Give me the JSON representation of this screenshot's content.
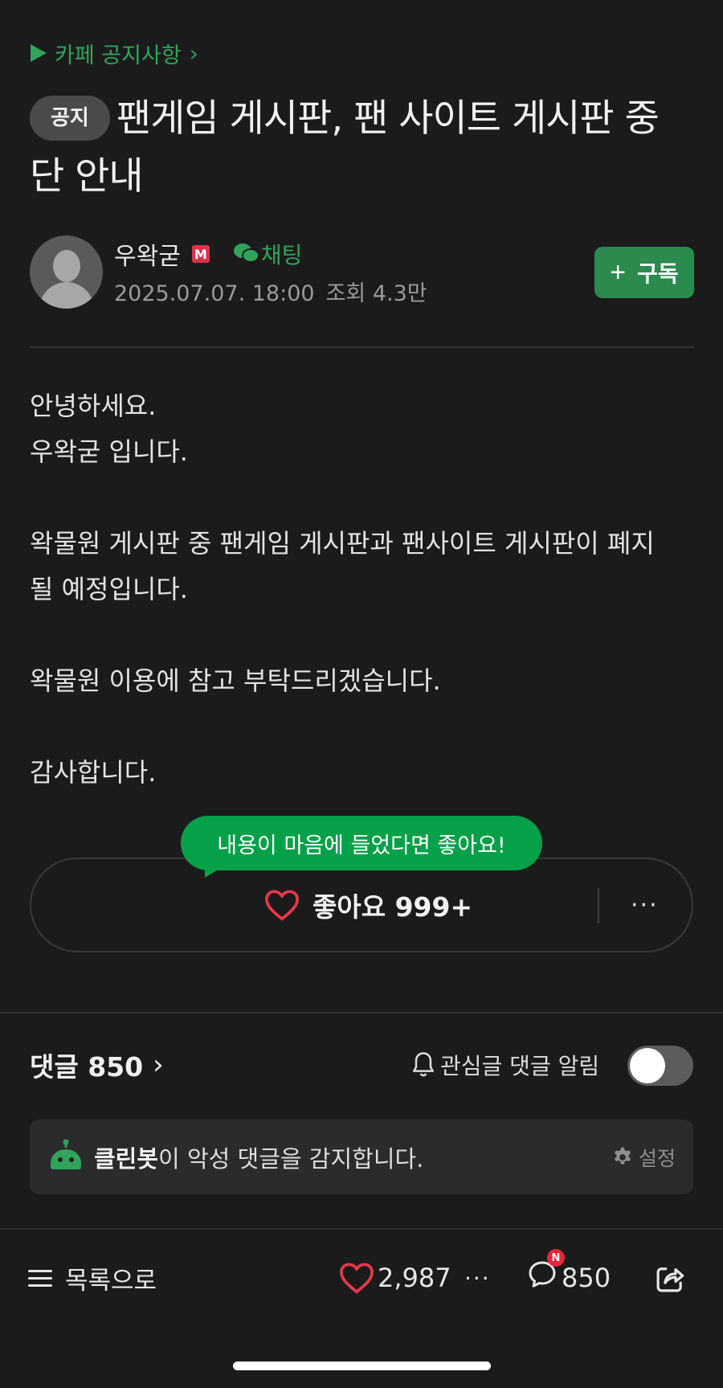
{
  "breadcrumb": {
    "label": "카페 공지사항"
  },
  "post": {
    "badge": "공지",
    "title": "팬게임 게시판, 팬 사이트 게시판 중단 안내",
    "author": "우왁굳",
    "level_badge": "M",
    "chat_label": "채팅",
    "date": "2025.07.07. 18:00",
    "views": "조회 4.3만",
    "subscribe_label": "구독",
    "body": [
      "안녕하세요.",
      "우왁굳 입니다.",
      "",
      "왁물원 게시판 중 팬게임 게시판과 팬사이트 게시판이 폐지 될 예정입니다.",
      "",
      "왁물원 이용에 참고 부탁드리겠습니다.",
      "",
      "감사합니다."
    ]
  },
  "like_box": {
    "tooltip": "내용이 마음에 들었다면 좋아요!",
    "like_label": "좋아요 999+",
    "more": "···"
  },
  "comments": {
    "title": "댓글 850",
    "alert_label": "관심글 댓글 알림",
    "alert_enabled": false
  },
  "cleanbot": {
    "name": "클린봇",
    "message": "이 악성 댓글을 감지합니다.",
    "settings_label": "설정"
  },
  "bottom_bar": {
    "list_label": "목록으로",
    "like_count": "2,987",
    "more": "···",
    "new_badge": "N",
    "comment_count": "850"
  },
  "colors": {
    "accent": "#2ea55a",
    "tooltip": "#06a048",
    "heart": "#e8394a",
    "background": "#1b1b1c"
  },
  "icons": [
    "play-triangle-icon",
    "chevron-right-icon",
    "avatar-icon",
    "chat-icon",
    "plus-icon",
    "heart-icon",
    "more-icon",
    "bell-icon",
    "robot-icon",
    "gear-icon",
    "hamburger-icon",
    "comment-icon",
    "share-icon"
  ]
}
